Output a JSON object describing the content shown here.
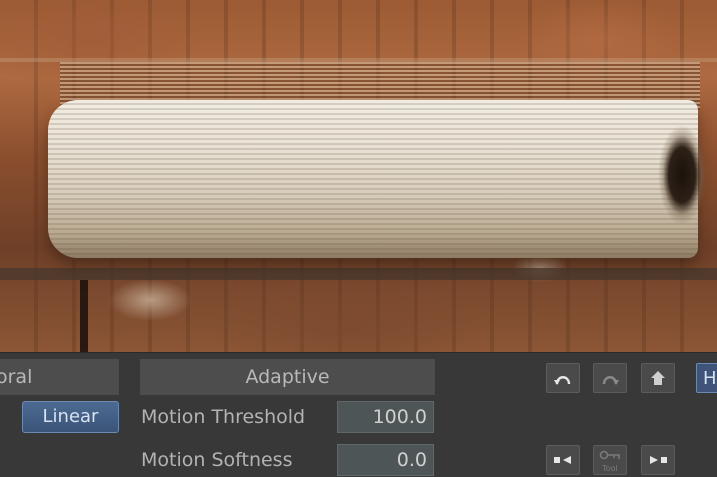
{
  "panel": {
    "temporal_header": "oral",
    "adaptive_header": "Adaptive",
    "linear_button": "Linear",
    "motion_threshold_label": "Motion Threshold",
    "motion_threshold_value": "100.0",
    "motion_softness_label": "Motion Softness",
    "motion_softness_value": "0.0",
    "h_button": "H",
    "tool_label": "Tool"
  },
  "icons": {
    "undo": "undo-arc-icon",
    "redo": "redo-arc-icon",
    "home": "home-icon",
    "prev": "step-back-icon",
    "tool": "key-tool-icon",
    "next": "step-forward-icon"
  },
  "colors": {
    "panel_bg": "#383838",
    "header_bg": "#4d4d4d",
    "active_button": "#4c6a92",
    "field_bg": "#4e5556"
  }
}
